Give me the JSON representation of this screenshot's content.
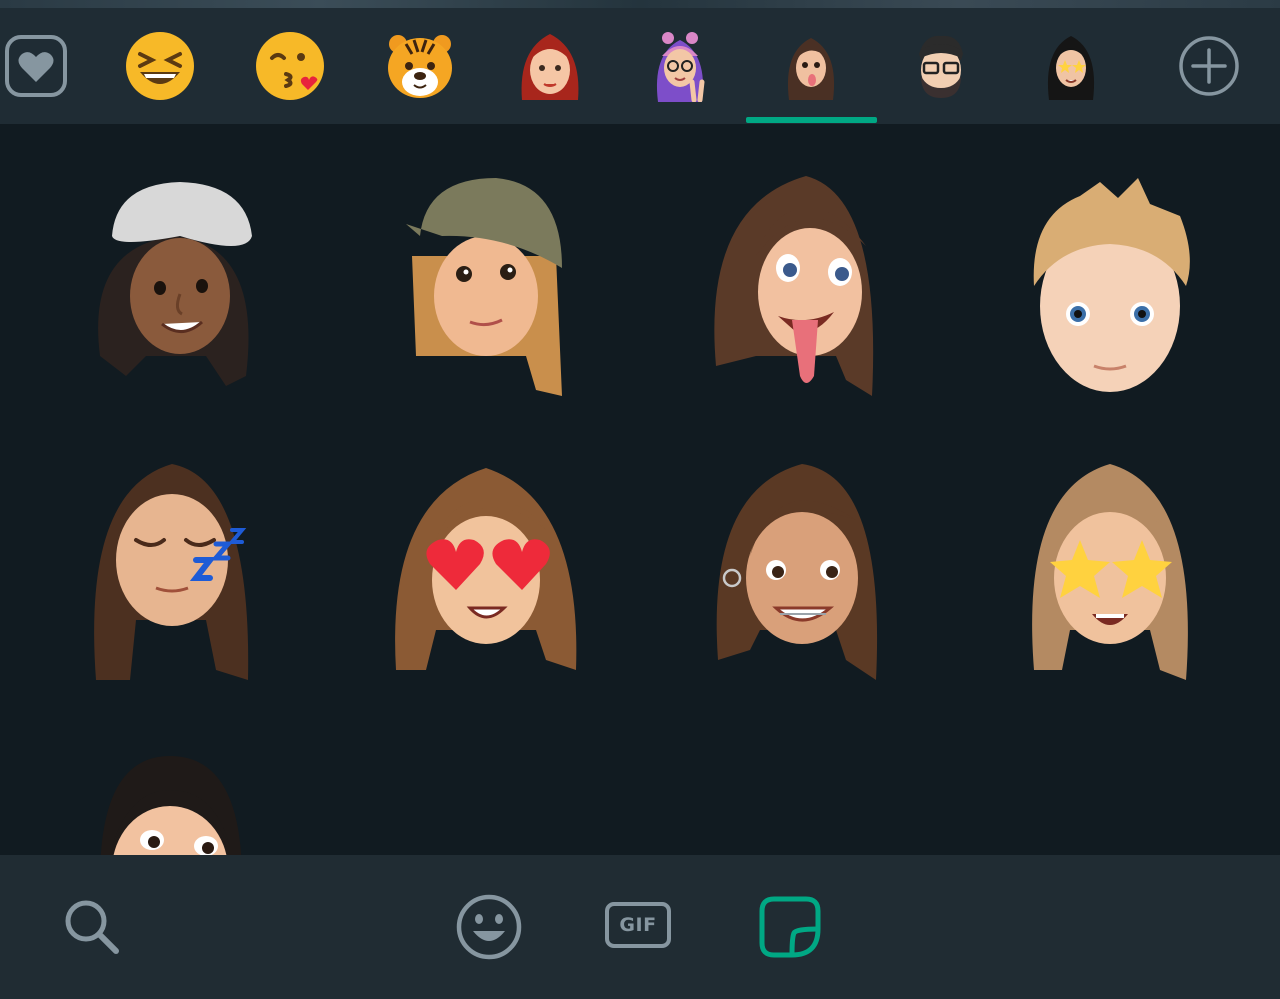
{
  "tabs": [
    {
      "id": "favorites",
      "icon": "heart-icon"
    },
    {
      "id": "pack-1",
      "icon": "laughing-face-emoji"
    },
    {
      "id": "pack-2",
      "icon": "kissing-heart-face-emoji"
    },
    {
      "id": "pack-3",
      "icon": "tiger-face-emoji"
    },
    {
      "id": "pack-4",
      "icon": "red-hair-memoji"
    },
    {
      "id": "pack-5",
      "icon": "purple-hair-peace-memoji"
    },
    {
      "id": "pack-6",
      "icon": "brown-hair-tongue-memoji"
    },
    {
      "id": "pack-7",
      "icon": "glasses-beard-memoji"
    },
    {
      "id": "pack-8",
      "icon": "black-hair-star-eyes-memoji"
    },
    {
      "id": "add",
      "icon": "add-icon"
    }
  ],
  "selected_tab_index": 6,
  "stickers": [
    {
      "name": "white-cap-memoji",
      "hair": "#2b221f",
      "skin": "#8a5a3c",
      "hat": "#d8d8d8"
    },
    {
      "name": "olive-cap-memoji",
      "hair": "#c98f4c",
      "skin": "#f0b991",
      "hat": "#7b7a5c"
    },
    {
      "name": "tongue-out-memoji",
      "hair": "#5a3a28",
      "skin": "#f2c1a0"
    },
    {
      "name": "blond-boy-memoji",
      "hair": "#d9ad74",
      "skin": "#f5d2b8"
    },
    {
      "name": "sleeping-zzz-memoji",
      "hair": "#4c3020",
      "skin": "#e7b590"
    },
    {
      "name": "heart-eyes-memoji",
      "hair": "#8b5a34",
      "skin": "#f1c39c"
    },
    {
      "name": "smiling-braces-memoji",
      "hair": "#5a3924",
      "skin": "#d9a07a"
    },
    {
      "name": "star-eyes-memoji",
      "hair": "#b48a62",
      "skin": "#f0c29d"
    },
    {
      "name": "black-hair-partial-memoji",
      "hair": "#1f1a18",
      "skin": "#f2c2a0"
    }
  ],
  "bottom_bar": {
    "search_icon": "search-icon",
    "emoji_icon": "smiley-icon",
    "gif_label": "GIF",
    "sticker_icon": "sticker-icon"
  },
  "colors": {
    "accent": "#00a884",
    "icon_gray": "#8696a0",
    "panel_bg": "#111b21",
    "bar_bg": "#1f2c34"
  }
}
